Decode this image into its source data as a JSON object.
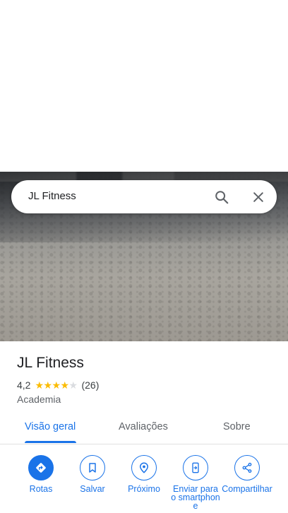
{
  "search": {
    "query": "JL Fitness"
  },
  "place": {
    "name": "JL Fitness",
    "rating": "4,2",
    "stars": 4.2,
    "review_count": "(26)",
    "category": "Academia"
  },
  "tabs": [
    {
      "label": "Visão geral",
      "active": true
    },
    {
      "label": "Avaliações",
      "active": false
    },
    {
      "label": "Sobre",
      "active": false
    }
  ],
  "actions": [
    {
      "label": "Rotas",
      "icon": "directions-icon"
    },
    {
      "label": "Salvar",
      "icon": "bookmark-icon"
    },
    {
      "label": "Próximo",
      "icon": "nearby-icon"
    },
    {
      "label": "Enviar para o smartphone",
      "icon": "send-to-phone-icon"
    },
    {
      "label": "Compartilhar",
      "icon": "share-icon"
    }
  ],
  "colors": {
    "accent": "#1a73e8",
    "star": "#fbbc04",
    "star_empty": "#dadce0"
  }
}
